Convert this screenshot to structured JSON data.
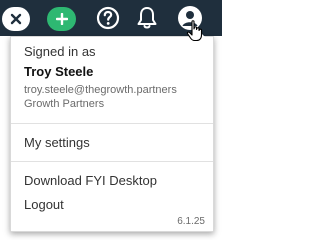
{
  "topbar": {
    "background": "#1f2f3d",
    "close_icon": "close-icon",
    "add_icon": "plus-icon",
    "help_icon": "help-circle-icon",
    "bell_icon": "bell-icon",
    "avatar_icon": "user-avatar-icon",
    "add_color": "#2eb872"
  },
  "account_menu": {
    "signed_in_label": "Signed in as",
    "user_name": "Troy Steele",
    "user_email": "troy.steele@thegrowth.partners",
    "organization": "Growth Partners",
    "items": [
      {
        "label": "My settings"
      },
      {
        "label": "Download FYI Desktop"
      },
      {
        "label": "Logout"
      }
    ],
    "version": "6.1.25"
  }
}
